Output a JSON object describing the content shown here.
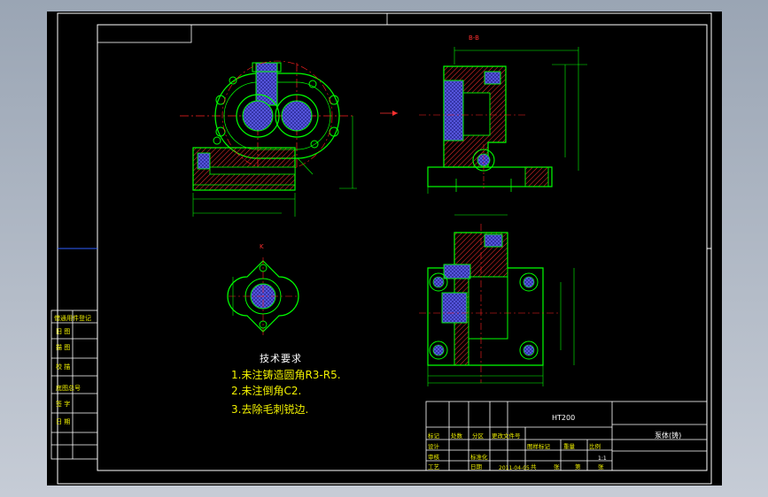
{
  "technical_requirements": {
    "title": "技术要求",
    "notes": [
      "1.未注铸造圆角R3-R5.",
      "2.未注倒角C2.",
      "3.去除毛刺锐边."
    ]
  },
  "title_block": {
    "material": "HT200",
    "part_name": "泵体(铸)",
    "scale": "1:1",
    "date": "2011-04-05"
  },
  "views": {
    "section_label": "B-B",
    "view_label": "K"
  },
  "colors": {
    "background": "#000000",
    "outline": "#00ff00",
    "frame": "#ffffff",
    "centerline": "#ff2020",
    "hatch": "#ff3030",
    "section_fill": "#4040ff",
    "text": "#f0f000"
  }
}
